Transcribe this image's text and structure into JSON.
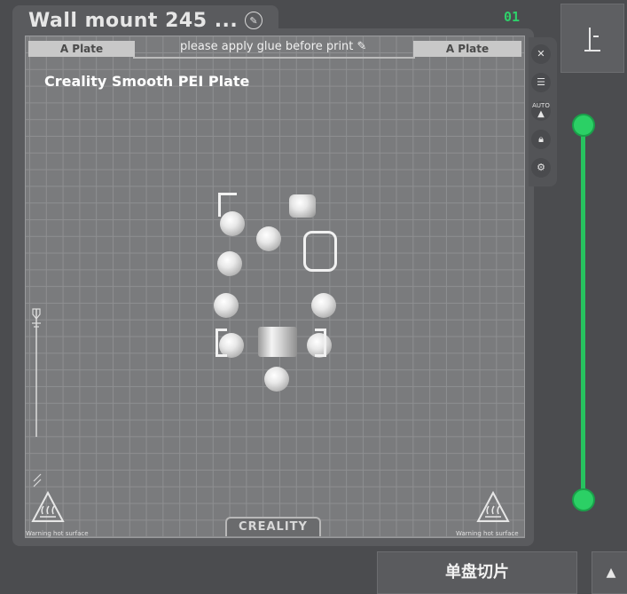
{
  "header": {
    "title": "Wall mount 245 ...",
    "edit_icon": "pencil-icon"
  },
  "plate": {
    "left_tab": "A Plate",
    "right_tab": "A Plate",
    "notice": "please apply glue before print",
    "notice_icon": "pencil-icon",
    "plate_type": "Creality Smooth PEI Plate",
    "brand": "CREALITY",
    "warning_left": "Warning hot surface",
    "warning_right": "Warning hot surface"
  },
  "side_toolbar": {
    "items": [
      {
        "icon": "close-icon"
      },
      {
        "icon": "list-icon"
      },
      {
        "icon": "auto-arrange-icon",
        "label": "AUTO"
      },
      {
        "icon": "lock-icon"
      },
      {
        "icon": "gear-icon"
      }
    ]
  },
  "layer_slider": {
    "top_label": "01",
    "accent_color": "#2bd065"
  },
  "footer": {
    "slice_button": "单盘切片",
    "more_icon": "chevron-up-icon"
  }
}
